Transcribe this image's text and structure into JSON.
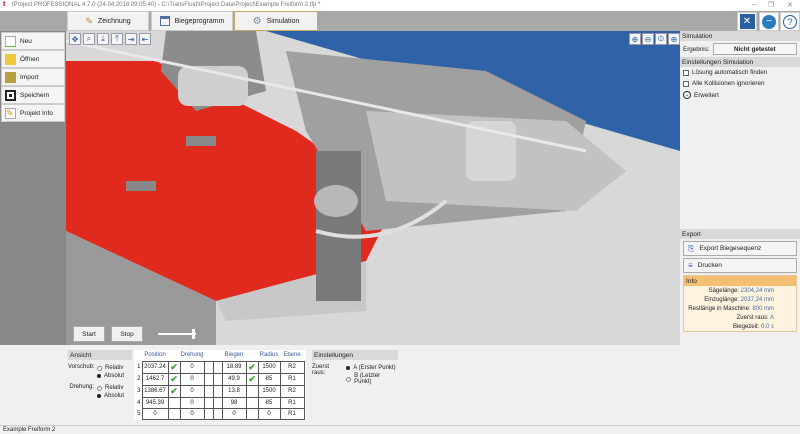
{
  "titlebar": {
    "title": "tProject PROFESSIONAL 4.7.0 (24.04.2018 09:05:40) - C:\\TransFluid\\tProject Data\\Project\\Example Freiform 2.tfp *",
    "logo": "t"
  },
  "tabs": [
    {
      "label": "Zeichnung"
    },
    {
      "label": "Biegeprogramm"
    },
    {
      "label": "Simulation"
    }
  ],
  "sidebar": [
    {
      "label": "Neu"
    },
    {
      "label": "Öffnen"
    },
    {
      "label": "Import"
    },
    {
      "label": "Speichern"
    },
    {
      "label": "Projekt Info"
    }
  ],
  "viewport": {
    "start": "Start",
    "stop": "Stop",
    "speed": 0.9
  },
  "right": {
    "simulation_header": "Simulation",
    "ergebnis_label": "Ergebnis:",
    "ergebnis_value": "Nicht getestet",
    "settings_header": "Einstellungen Simulation",
    "options": [
      {
        "label": "Lösung automatisch finden",
        "checked": false
      },
      {
        "label": "Alle Kollisionen ignorieren",
        "checked": false
      }
    ],
    "erweitert": "Erweitert",
    "export_header": "Export",
    "export_button": "Export Biegesequenz",
    "print_button": "Drucken",
    "info_header": "Info",
    "info": [
      {
        "label": "Sägelänge:",
        "value": "2304,24 mm"
      },
      {
        "label": "Einzuglänge:",
        "value": "2037,24 mm"
      },
      {
        "label": "Restlänge in Maschine:",
        "value": "800 mm"
      },
      {
        "label": "Zuerst raus:",
        "value": "A"
      },
      {
        "label": "Biegezeit:",
        "value": "0,0 s"
      }
    ]
  },
  "ansicht": {
    "header": "Ansicht",
    "vorschub": "Vorschub:",
    "drehung": "Drehung:",
    "relativ": "Relativ",
    "absolut": "Absolut"
  },
  "table": {
    "headers": [
      "Position",
      "Drehung",
      "Biegen",
      "Radius",
      "Ebene"
    ],
    "rows": [
      {
        "n": "1",
        "pos": "2037.24",
        "pos_ok": true,
        "dreh": "0",
        "bieg": "18.89",
        "bieg_ok": true,
        "rad": "1500",
        "eb": "R2"
      },
      {
        "n": "2",
        "pos": "1462.7",
        "pos_ok": true,
        "dreh": "0",
        "bieg": "49.9",
        "bieg_ok": true,
        "rad": "85",
        "eb": "R1"
      },
      {
        "n": "3",
        "pos": "1386.67",
        "pos_ok": true,
        "dreh": "0",
        "bieg": "13.8",
        "bieg_ok": false,
        "rad": "1500",
        "eb": "R2"
      },
      {
        "n": "4",
        "pos": "945.39",
        "pos_ok": false,
        "dreh": "0",
        "bieg": "98",
        "bieg_ok": false,
        "rad": "85",
        "eb": "R1"
      },
      {
        "n": "5",
        "pos": "0",
        "pos_ok": false,
        "dreh": "0",
        "bieg": "0",
        "bieg_ok": false,
        "rad": "0",
        "eb": "R1"
      }
    ]
  },
  "einstellungen": {
    "header": "Einstellungen",
    "zuerst": "Zuerst raus:",
    "a": "A (Erster Punkt)",
    "b": "B (Letzter Punkt)"
  },
  "status": "Example Freiform 2"
}
